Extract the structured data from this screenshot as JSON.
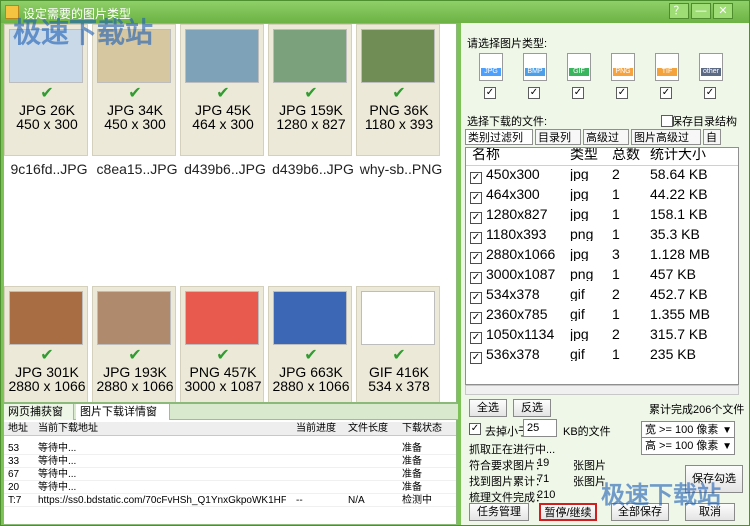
{
  "window": {
    "title": "设定需要的图片类型",
    "controls": [
      "？",
      "—",
      "✕"
    ]
  },
  "gallery": {
    "top": [
      {
        "fmt": "JPG 26K",
        "size": "450 x 300",
        "name": "9c16fd..JPG",
        "color": "#c9d9e7"
      },
      {
        "fmt": "JPG 34K",
        "size": "450 x 300",
        "name": "c8ea15..JPG",
        "color": "#d6c7a1"
      },
      {
        "fmt": "JPG 45K",
        "size": "464 x 300",
        "name": "d439b6..JPG",
        "color": "#7ea2b8"
      },
      {
        "fmt": "JPG 159K",
        "size": "1280 x 827",
        "name": "d439b6..JPG",
        "color": "#7aa07c"
      },
      {
        "fmt": "PNG 36K",
        "size": "1180 x 393",
        "name": "why-sb..PNG",
        "color": "#6f8d55"
      }
    ],
    "bottom": [
      {
        "fmt": "JPG 301K",
        "size": "2880 x 1066",
        "color": "#a86d43"
      },
      {
        "fmt": "JPG 193K",
        "size": "2880 x 1066",
        "color": "#b08a6d"
      },
      {
        "fmt": "PNG 457K",
        "size": "3000 x 1087",
        "color": "#e95a4e"
      },
      {
        "fmt": "JPG 663K",
        "size": "2880 x 1066",
        "color": "#3c67b4"
      },
      {
        "fmt": "GIF 416K",
        "size": "534 x 378",
        "color": "#ffffff"
      }
    ]
  },
  "bottom_tabs": [
    "网页捕获窗口",
    "图片下载详情窗口"
  ],
  "download_table": {
    "headers": [
      "地址",
      "当前下载地址",
      "当前进度",
      "文件长度",
      "下载状态"
    ],
    "rows": [
      [
        "53",
        "等待中...",
        "",
        "",
        "准备"
      ],
      [
        "33",
        "等待中...",
        "",
        "",
        "准备"
      ],
      [
        "67",
        "等待中...",
        "",
        "",
        "准备"
      ],
      [
        "20",
        "等待中...",
        "",
        "",
        "准备"
      ],
      [
        "T:7",
        "https://ss0.bdstatic.com/70cFvHSh_Q1YnxGkpoWK1HF...",
        "--",
        "N/A",
        "检测中"
      ]
    ]
  },
  "right": {
    "select_type_label": "请选择图片类型:",
    "types": [
      {
        "name": "JPG",
        "color": "#4ca0ff"
      },
      {
        "name": "BMP",
        "color": "#4b9ee8"
      },
      {
        "name": "GIF",
        "color": "#39b55d"
      },
      {
        "name": "PNG",
        "color": "#f7a23d"
      },
      {
        "name": "TIF",
        "color": "#f3a23c"
      },
      {
        "name": "other",
        "color": "#5d6a86"
      }
    ],
    "select_files_label": "选择下载的文件:",
    "save_dir_label": "保存目录结构",
    "subtabs": [
      "类别过滤列表",
      "目录列表",
      "高级过滤",
      "图片高级过滤",
      "自"
    ],
    "list_headers": [
      "名称",
      "类型",
      "总数",
      "统计大小"
    ],
    "list_rows": [
      [
        "450x300",
        "jpg",
        "2",
        "58.64 KB"
      ],
      [
        "464x300",
        "jpg",
        "1",
        "44.22 KB"
      ],
      [
        "1280x827",
        "jpg",
        "1",
        "158.1 KB"
      ],
      [
        "1180x393",
        "png",
        "1",
        "35.3 KB"
      ],
      [
        "2880x1066",
        "jpg",
        "3",
        "1.128 MB"
      ],
      [
        "3000x1087",
        "png",
        "1",
        "457 KB"
      ],
      [
        "534x378",
        "gif",
        "2",
        "452.7 KB"
      ],
      [
        "2360x785",
        "gif",
        "1",
        "1.355 MB"
      ],
      [
        "1050x1134",
        "jpg",
        "2",
        "315.7 KB"
      ],
      [
        "536x378",
        "gif",
        "1",
        "235 KB"
      ]
    ],
    "buttons": {
      "select_all": "全选",
      "invert": "反选",
      "task_manage": "任务管理",
      "pause": "暂停/继续",
      "save_all": "全部保存",
      "cancel": "取消",
      "save_checked": "保存勾选"
    },
    "filter": {
      "remove_small": "去掉小于",
      "small_value": "25",
      "kb_file": "KB的文件"
    },
    "stats": {
      "done_text": "累计完成206个文件",
      "crawling": "抓取正在进行中...",
      "matched_label": "符合要求图片：",
      "matched_val": "19",
      "matched_unit": "张图片",
      "found_label": "找到图片累计：",
      "found_val": "71",
      "found_unit": "张图片",
      "complete_label": "梳理文件完成：",
      "complete_val": "210"
    },
    "width_filter": "宽 >= 100 像素",
    "height_filter": "高 >= 100 像素"
  },
  "watermarks": [
    "极速下载站",
    "极速下载站"
  ]
}
